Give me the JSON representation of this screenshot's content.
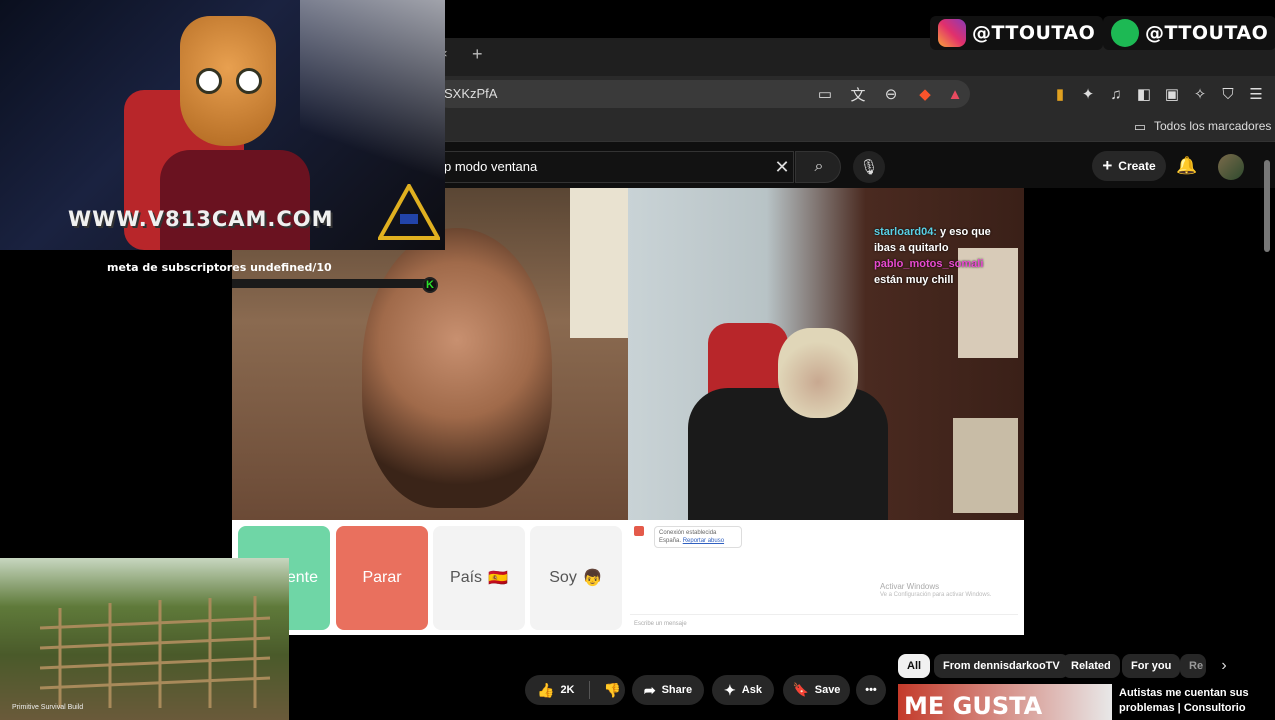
{
  "browser": {
    "url_fragment": "SXKzPfA",
    "bookmarks_label": "Todos los marcadores",
    "new_tab": "+",
    "close_tab": "×"
  },
  "youtube": {
    "search_value": "p modo ventana",
    "create_label": "Create"
  },
  "overlay": {
    "watermark": "WWW.V813CAM.COM",
    "goal_text": "meta de subscriptores undefined/10",
    "socials": [
      {
        "platform": "instagram",
        "handle": "@TTOUTAO"
      },
      {
        "platform": "spotify",
        "handle": "@TTOUTAO"
      }
    ],
    "tiny_caption": "Primitive Survival Build"
  },
  "stream": {
    "chat": [
      {
        "user": "starloard04:",
        "text": "y eso que ibas a quitarlo"
      },
      {
        "user": "pablo_motos_somali",
        "text": "están muy chill"
      }
    ],
    "controls": {
      "next_label": "ente",
      "stop_label": "Parar",
      "country_label": "País",
      "country_flag": "🇪🇸",
      "gender_label": "Soy",
      "gender_emoji": "👦"
    },
    "chatbox": {
      "status": "Conexión establecida",
      "location": "España.",
      "report_link": "Reportar abuso",
      "input_placeholder": "Escribe un mensaje",
      "activate_title": "Activar Windows",
      "activate_sub": "Ve a Configuración para activar Windows."
    }
  },
  "actions": {
    "likes": "2K",
    "share": "Share",
    "ask": "Ask",
    "save": "Save"
  },
  "chips": [
    "All",
    "From dennisdarkooTV",
    "Related",
    "For you",
    "Re"
  ],
  "related": {
    "thumb_text": "ME GUSTA",
    "title": "Autistas me cuentan sus problemas | Consultorio"
  },
  "colors": {
    "stop_button": "#e9705e",
    "next_button": "#6fd6a6",
    "chat_user1": "#5ad1e6",
    "chat_user2": "#e84ad0"
  }
}
